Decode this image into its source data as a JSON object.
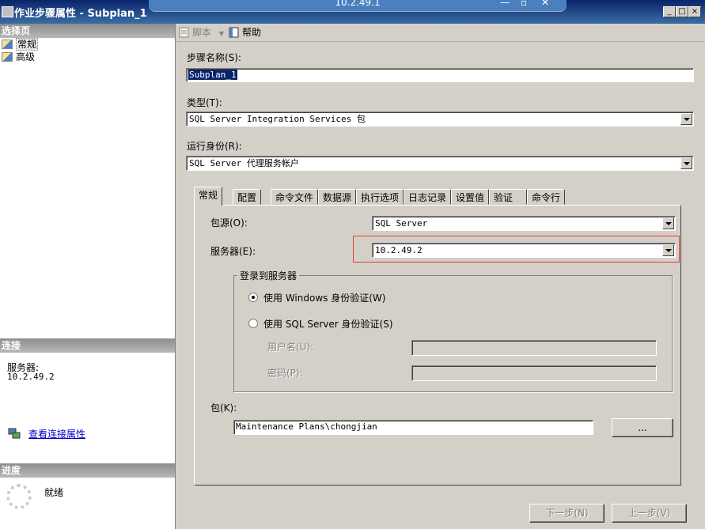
{
  "remote_bar": {
    "ip": "10.2.49.1",
    "minimize": "—",
    "restore": "▫",
    "close": "✕"
  },
  "window": {
    "title": "作业步骤属性 - Subplan_1",
    "min": "_",
    "max": "□",
    "close": "×"
  },
  "left": {
    "select_page_header": "选择页",
    "pages": [
      {
        "label": "常规"
      },
      {
        "label": "高级"
      }
    ],
    "connection_header": "连接",
    "server_label": "服务器:",
    "server_value": "10.2.49.2",
    "view_connection_link": "查看连接属性",
    "progress_header": "进度",
    "progress_status": "就绪"
  },
  "toolbar": {
    "script_label": "脚本",
    "help_label": "帮助"
  },
  "form": {
    "step_name_label": "步骤名称(S):",
    "step_name_value": "Subplan_1",
    "type_label": "类型(T):",
    "type_value": "SQL Server Integration Services 包",
    "run_as_label": "运行身份(R):",
    "run_as_value": "SQL Server 代理服务帐户"
  },
  "tabs": [
    {
      "label": "常规"
    },
    {
      "label": "配置"
    },
    {
      "label": "命令文件"
    },
    {
      "label": "数据源"
    },
    {
      "label": "执行选项"
    },
    {
      "label": "日志记录"
    },
    {
      "label": "设置值"
    },
    {
      "label": "验证"
    },
    {
      "label": "命令行"
    }
  ],
  "general": {
    "package_source_label": "包源(O):",
    "package_source_value": "SQL Server",
    "server_label": "服务器(E):",
    "server_value": "10.2.49.2",
    "login_group_label": "登录到服务器",
    "windows_auth_label": "使用 Windows 身份验证(W)",
    "sql_auth_label": "使用 SQL Server 身份验证(S)",
    "username_label": "用户名(U):",
    "password_label": "密码(P):",
    "package_label": "包(K):",
    "package_value": "Maintenance Plans\\chongjian",
    "browse_label": "..."
  },
  "footer": {
    "next_label": "下一步(N)",
    "prev_label": "上一步(V)"
  },
  "colors": {
    "highlight_box": "#e04040",
    "title_bar": "#0a246a"
  }
}
